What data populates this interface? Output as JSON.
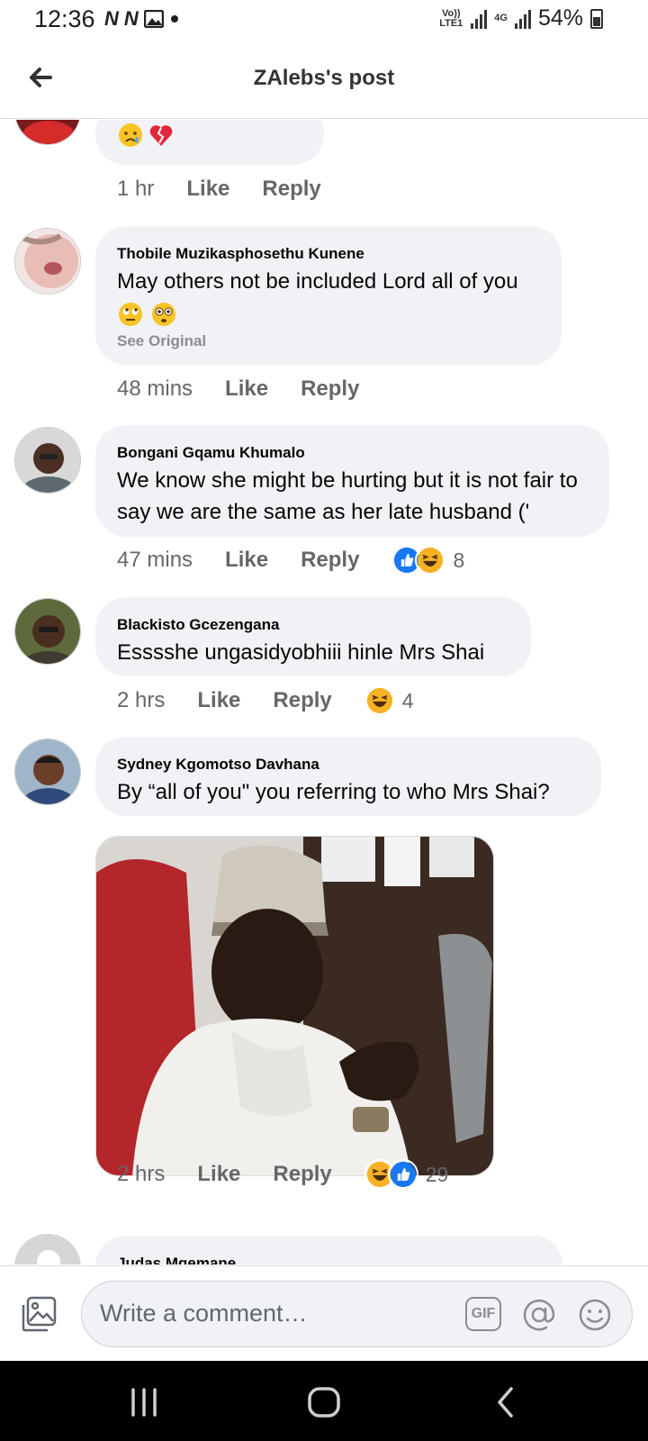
{
  "status": {
    "time": "12:36",
    "notif_icons": [
      "N",
      "N"
    ],
    "volte": "Vo)) LTE1",
    "network": "4G",
    "battery": "54%"
  },
  "header": {
    "title": "ZAlebs's post"
  },
  "comments": [
    {
      "author": "",
      "text": "",
      "emojis": [
        "crying-face",
        "broken-heart"
      ],
      "time": "1 hr",
      "like": "Like",
      "reply": "Reply"
    },
    {
      "author": "Thobile Muzikasphosethu Kunene",
      "text": "May others not be included Lord all of you",
      "emojis": [
        "eye-roll-face",
        "flushed-face"
      ],
      "see_original": "See Original",
      "time": "48 mins",
      "like": "Like",
      "reply": "Reply"
    },
    {
      "author": "Bongani Gqamu Khumalo",
      "text": "We know she might be hurting but it is not fair to say we are the same as her late husband ('",
      "time": "47 mins",
      "like": "Like",
      "reply": "Reply",
      "reactions": [
        "like",
        "haha"
      ],
      "reaction_count": "8"
    },
    {
      "author": "Blackisto Gcezengana",
      "text": "Esssshe ungasidyobhiii hinle Mrs Shai",
      "time": "2 hrs",
      "like": "Like",
      "reply": "Reply",
      "reactions": [
        "haha"
      ],
      "reaction_count": "4"
    },
    {
      "author": "Sydney Kgomotso Davhana",
      "text": "By “all of you\" you referring to who Mrs Shai?",
      "has_photo": true,
      "time": "2 hrs",
      "like": "Like",
      "reply": "Reply",
      "reactions": [
        "haha",
        "like"
      ],
      "reaction_count": "29"
    },
    {
      "author": "Judas Mgemane"
    }
  ],
  "composer": {
    "placeholder": "Write a comment…",
    "gif": "GIF"
  },
  "colors": {
    "bubble": "#f0f2f5",
    "meta": "#65676b",
    "like_blue": "#1877f2",
    "haha_yellow": "#f7b125"
  }
}
